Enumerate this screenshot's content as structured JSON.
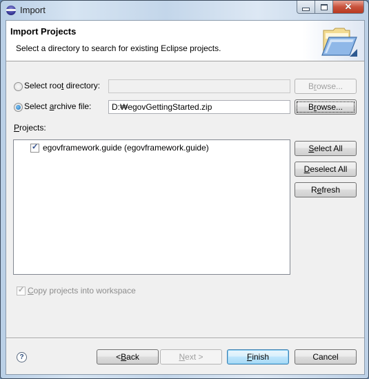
{
  "window": {
    "title": "Import",
    "app_icon": "eclipse-icon",
    "controls": {
      "minimize": "minimize-icon",
      "maximize": "maximize-icon",
      "close": "close-icon",
      "close_glyph": "✕"
    }
  },
  "header": {
    "title": "Import Projects",
    "description": "Select a directory to search for existing Eclipse projects.",
    "icon": "open-folder-icon"
  },
  "source": {
    "root_directory": {
      "label_pre": "Select roo",
      "label_mnemonic": "t",
      "label_post": " directory:",
      "selected": false,
      "value": "",
      "browse_pre": "B",
      "browse_mnemonic": "r",
      "browse_post": "owse...",
      "enabled": false
    },
    "archive_file": {
      "label_pre": "Select ",
      "label_mnemonic": "a",
      "label_post": "rchive file:",
      "selected": true,
      "value": "D:₩egovGettingStarted.zip",
      "browse_pre": "B",
      "browse_mnemonic": "r",
      "browse_post": "owse...",
      "enabled": true
    }
  },
  "projects": {
    "label_mnemonic": "P",
    "label_post": "rojects:",
    "items": [
      {
        "label": "egovframework.guide (egovframework.guide)",
        "checked": true
      }
    ],
    "buttons": {
      "select_all": {
        "mnemonic": "S",
        "post": "elect All"
      },
      "deselect_all": {
        "mnemonic": "D",
        "post": "eselect All"
      },
      "refresh": {
        "pre": "R",
        "mnemonic": "e",
        "post": "fresh"
      }
    }
  },
  "options": {
    "copy_into_workspace": {
      "mnemonic": "C",
      "post": "opy projects into workspace",
      "checked": true,
      "enabled": false
    }
  },
  "footer": {
    "help_glyph": "?",
    "back": {
      "pre": "< ",
      "mnemonic": "B",
      "post": "ack",
      "enabled": true
    },
    "next": {
      "mnemonic": "N",
      "post": "ext >",
      "enabled": false
    },
    "finish": {
      "mnemonic": "F",
      "post": "inish",
      "enabled": true
    },
    "cancel": {
      "label": "Cancel",
      "enabled": true
    }
  },
  "check_glyph": "✓"
}
